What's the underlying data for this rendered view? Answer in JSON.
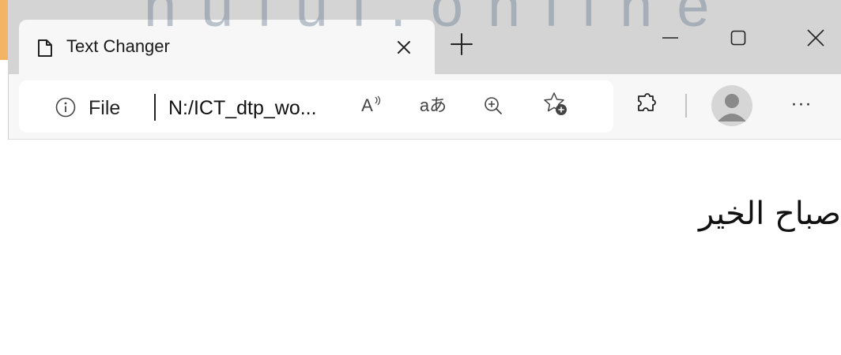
{
  "tab": {
    "title": "Text Changer",
    "page_icon": "page-icon",
    "close_icon": "close-icon"
  },
  "new_tab_icon": "plus-icon",
  "window_controls": {
    "minimize_icon": "minimize-icon",
    "maximize_icon": "maximize-icon",
    "close_icon": "close-icon"
  },
  "address_bar": {
    "info_icon": "info-icon",
    "scheme_label": "File",
    "url": "N:/ICT_dtp_wo..."
  },
  "toolbar": {
    "read_aloud_text": "A",
    "translate_text": "aあ",
    "more_label": "···"
  },
  "content": {
    "arabic_text": "صباح الخير"
  },
  "watermark": {
    "text": "nulul.online"
  },
  "colors": {
    "tab_strip": "#d4d4d4",
    "toolbar": "#f7f7f7",
    "accent": "#f2b566",
    "watermark": "#6e8296"
  }
}
